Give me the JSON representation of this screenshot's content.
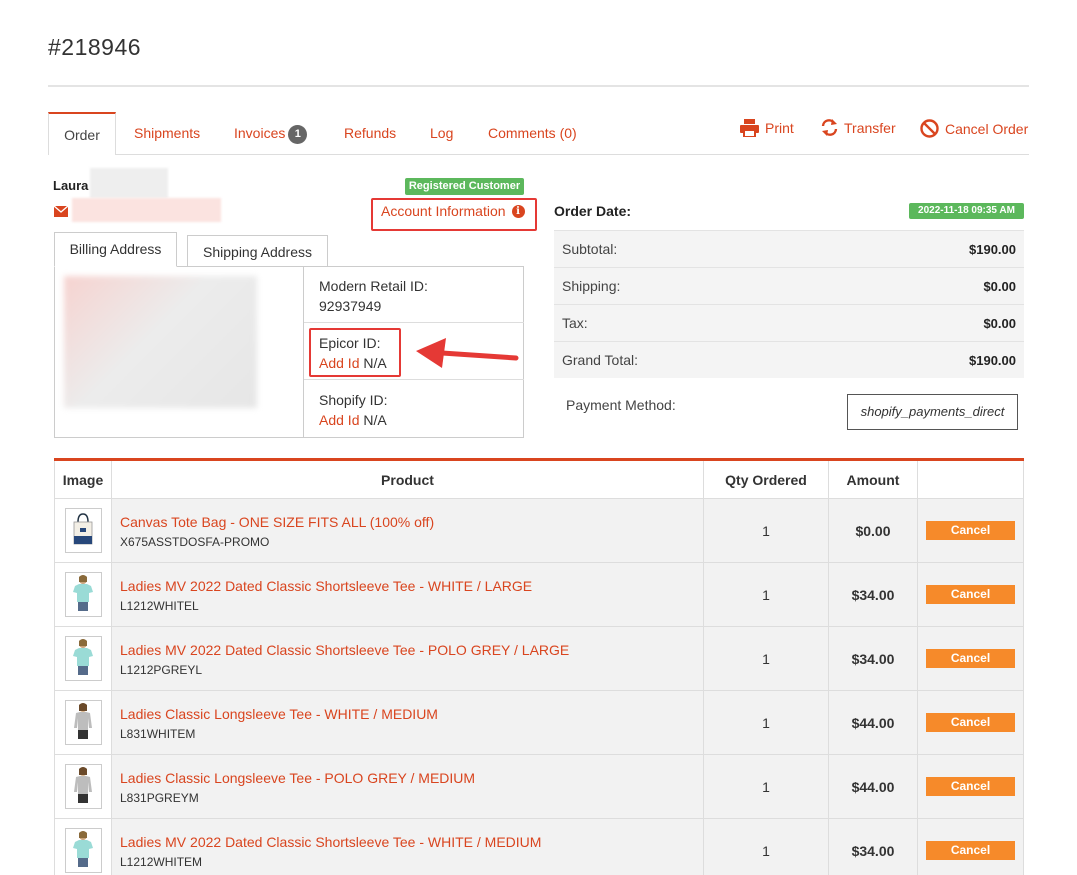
{
  "order": {
    "number": "#218946"
  },
  "tabs": [
    {
      "label": "Order"
    },
    {
      "label": "Shipments"
    },
    {
      "label": "Invoices",
      "badge": "1"
    },
    {
      "label": "Refunds"
    },
    {
      "label": "Log"
    },
    {
      "label": "Comments (0)"
    }
  ],
  "actions": {
    "print": "Print",
    "transfer": "Transfer",
    "cancel_order": "Cancel Order"
  },
  "customer": {
    "name": "Laura",
    "status_badge": "Registered Customer",
    "account_info": "Account Information"
  },
  "address_tabs": {
    "billing": "Billing Address",
    "shipping": "Shipping Address"
  },
  "ids": {
    "modern_retail_label": "Modern Retail ID:",
    "modern_retail_value": "92937949",
    "epicor_label": "Epicor ID:",
    "epicor_add": "Add Id",
    "epicor_value": "N/A",
    "shopify_label": "Shopify ID:",
    "shopify_add": "Add Id",
    "shopify_value": "N/A"
  },
  "summary": {
    "order_date_label": "Order Date:",
    "order_date": "2022-11-18 09:35 AM",
    "subtotal_label": "Subtotal:",
    "subtotal": "$190.00",
    "shipping_label": "Shipping:",
    "shipping": "$0.00",
    "tax_label": "Tax:",
    "tax": "$0.00",
    "grand_total_label": "Grand Total:",
    "grand_total": "$190.00",
    "payment_method_label": "Payment Method:",
    "payment_method": "shopify_payments_direct"
  },
  "table": {
    "headers": [
      "Image",
      "Product",
      "Qty Ordered",
      "Amount",
      ""
    ],
    "rows": [
      {
        "name": "Canvas Tote Bag - ONE SIZE FITS ALL (100% off)",
        "sku": "X675ASSTDOSFA-PROMO",
        "qty": "1",
        "amount": "$0.00",
        "action": "Cancel",
        "image": "tote-bag"
      },
      {
        "name": "Ladies MV 2022 Dated Classic Shortsleeve Tee - WHITE / LARGE",
        "sku": "L1212WHITEL",
        "qty": "1",
        "amount": "$34.00",
        "action": "Cancel",
        "image": "tee-shirt"
      },
      {
        "name": "Ladies MV 2022 Dated Classic Shortsleeve Tee - POLO GREY / LARGE",
        "sku": "L1212PGREYL",
        "qty": "1",
        "amount": "$34.00",
        "action": "Cancel",
        "image": "tee-shirt"
      },
      {
        "name": "Ladies Classic Longsleeve Tee - WHITE / MEDIUM",
        "sku": "L831WHITEM",
        "qty": "1",
        "amount": "$44.00",
        "action": "Cancel",
        "image": "longsleeve-tee"
      },
      {
        "name": "Ladies Classic Longsleeve Tee - POLO GREY / MEDIUM",
        "sku": "L831PGREYM",
        "qty": "1",
        "amount": "$44.00",
        "action": "Cancel",
        "image": "longsleeve-tee"
      },
      {
        "name": "Ladies MV 2022 Dated Classic Shortsleeve Tee - WHITE / MEDIUM",
        "sku": "L1212WHITEM",
        "qty": "1",
        "amount": "$34.00",
        "action": "Cancel",
        "image": "tee-shirt"
      }
    ]
  },
  "colors": {
    "accent": "#d9451f",
    "badge_green": "#5cb85c",
    "cancel_orange": "#f68a2a",
    "highlight_red": "#e53935"
  }
}
